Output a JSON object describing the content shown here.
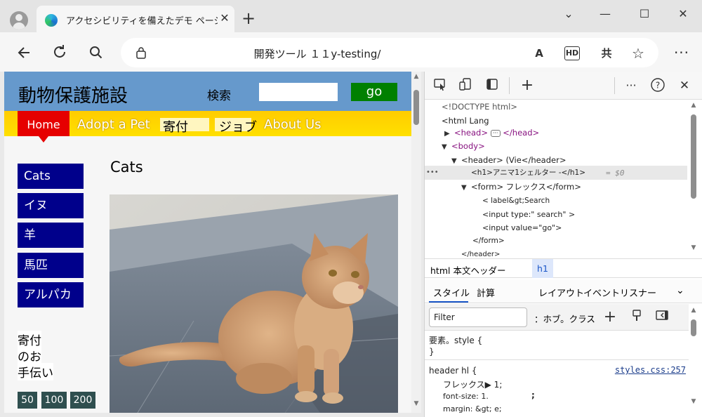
{
  "browser": {
    "tab_title": "アクセシビリティを備えたデモ ページは、",
    "tab_close": "✕",
    "new_tab": "+",
    "url": "開発ツール １１y-testing/",
    "addr_icons": [
      "A",
      "HD",
      "共",
      "☆"
    ],
    "menu": "···",
    "win_minimize": "—",
    "win_maximize": "☐",
    "win_close": "✕",
    "chevron": "⌄"
  },
  "site": {
    "title": "動物保護施設",
    "search_label": "検索",
    "search_value": "",
    "go_label": "go",
    "nav": {
      "home": "Home",
      "adopt": "Adopt a Pet",
      "donate": "寄付",
      "jobs": "ジョブ",
      "about": "About Us"
    },
    "sidebar": [
      "Cats",
      "イヌ",
      "羊",
      "馬匹",
      "アルパカ"
    ],
    "donate_lines": [
      "寄付",
      "のお",
      "手伝い"
    ],
    "amounts": [
      "50",
      "100",
      "200"
    ],
    "main_heading": "Cats"
  },
  "devtools": {
    "dom": {
      "doctype": "<!DOCTYPE html>",
      "html": "<html Lang",
      "head_open": "<head>",
      "head_close": "</head>",
      "body": "<body>",
      "header": "<header> (Vie</header>",
      "h1": "<h1>アニマ1シェルター -</h1>",
      "eq": "= $0",
      "form": "<form> フレックス</form>",
      "label": "< label&gt;Search",
      "input1": "<input type:\" search\" >",
      "input2": "<input value=\"go\">",
      "form_close": "</form>",
      "header_close": "</header>"
    },
    "crumbs": {
      "path": "html 本文ヘッダー",
      "selected": "h1"
    },
    "panel_tabs": [
      "スタイル",
      "計算",
      "レイアウト",
      "イベントリスナー"
    ],
    "filter_placeholder": "Filter",
    "hov_cls": "：ホブ。クラス",
    "rules": {
      "element_style": "要素。style {",
      "close_brace": "}",
      "selector": "header hl {",
      "source": "styles.css:257",
      "prop1": "フレックス▶ 1;",
      "prop2": "font-size: 1.",
      "prop2_semicolon": ";",
      "prop3": "margin: &gt; e;"
    }
  },
  "colors": {
    "header_blue": "#6699cc",
    "go_green": "#008000",
    "nav_yellow": "#ffcc00",
    "home_red": "#e60000",
    "sidebar_navy": "#00008b",
    "amount_slate": "#2f4f4f",
    "tag_purple": "#881280",
    "link_blue": "#1a3c8b"
  }
}
